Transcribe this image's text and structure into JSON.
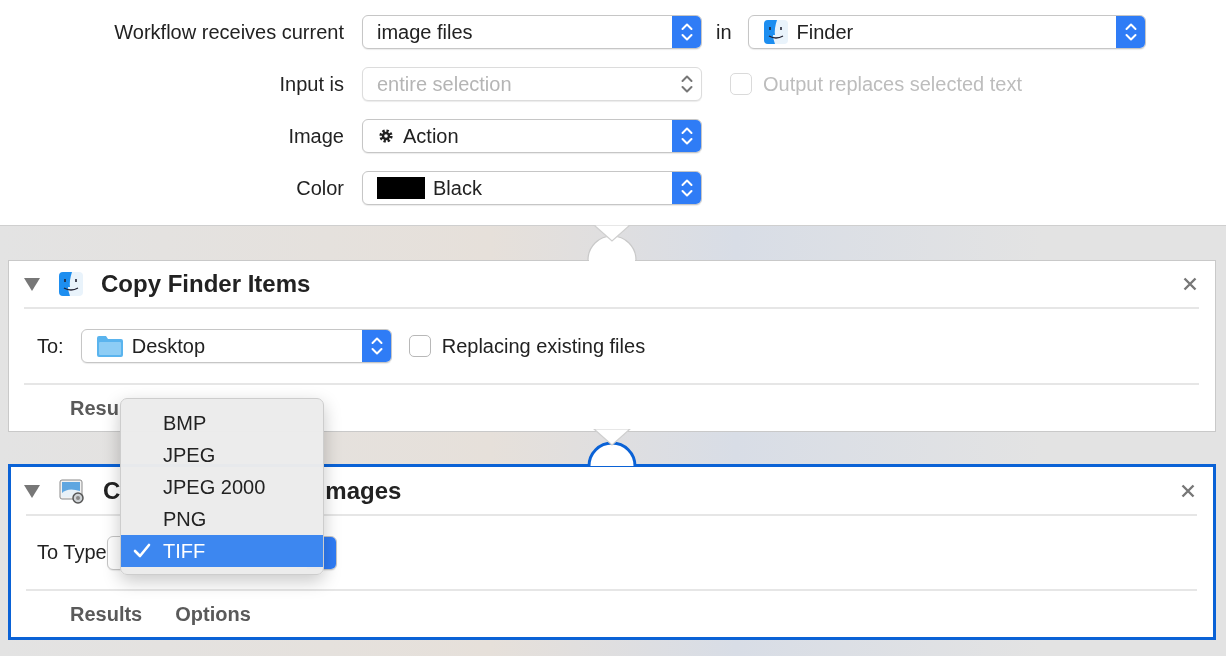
{
  "header": {
    "receives": {
      "label": "Workflow receives current",
      "value": "image files",
      "connector": "in",
      "application": "Finder"
    },
    "input": {
      "label": "Input is",
      "value": "entire selection",
      "disabled": true
    },
    "output_replaces": {
      "label": "Output replaces selected text",
      "checked": false,
      "disabled": true
    },
    "image": {
      "label": "Image",
      "value": "Action"
    },
    "color": {
      "label": "Color",
      "value": "Black"
    }
  },
  "actions": [
    {
      "kind": "finder",
      "title_parts": [
        "Copy Finder Items"
      ],
      "expanded": true,
      "selected": false,
      "controls": [
        {
          "kind": "label",
          "text": "To:"
        },
        {
          "kind": "location-popup",
          "value": "Desktop"
        },
        {
          "kind": "checkbox",
          "label": "Replacing existing files",
          "checked": false
        }
      ],
      "footer": [
        "Resu"
      ]
    },
    {
      "kind": "image",
      "title_parts": [
        "C",
        "mages"
      ],
      "expanded": true,
      "selected": true,
      "controls": [
        {
          "kind": "label",
          "text": "To Type"
        },
        {
          "kind": "popup"
        }
      ],
      "footer": [
        "Results",
        "Options"
      ]
    }
  ],
  "type_menu": {
    "items": [
      {
        "label": "BMP",
        "selected": false
      },
      {
        "label": "JPEG",
        "selected": false
      },
      {
        "label": "JPEG 2000",
        "selected": false
      },
      {
        "label": "PNG",
        "selected": false
      },
      {
        "label": "TIFF",
        "selected": true
      }
    ]
  }
}
